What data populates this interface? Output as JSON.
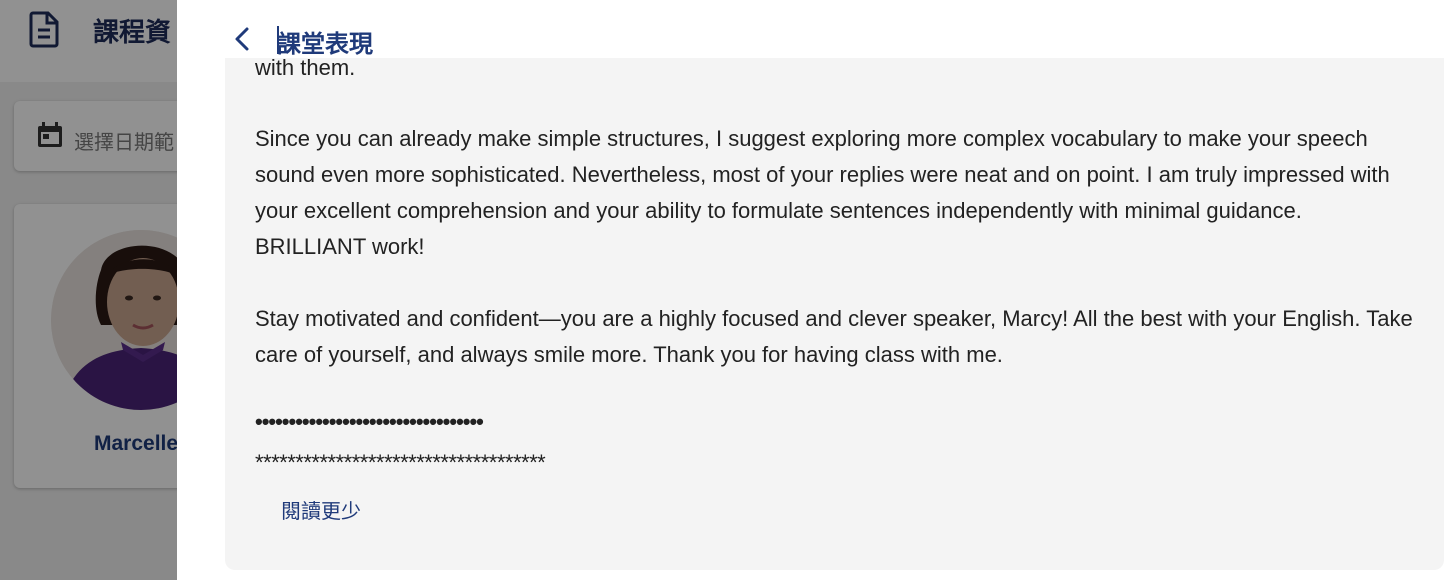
{
  "background": {
    "page_title": "課程資",
    "date_picker_placeholder": "選擇日期範",
    "tutor_name": "Marcelle"
  },
  "drawer": {
    "title": "課堂表現",
    "paragraphs": [
      "with them.",
      "Since you can already make simple structures, I suggest exploring more complex vocabulary to make your speech sound even more sophisticated. Nevertheless, most of your replies were neat and on point. I am truly impressed with your excellent comprehension and your ability to formulate sentences independently with minimal guidance. BRILLIANT work!",
      "Stay motivated and confident—you are a highly focused and clever speaker, Marcy! All the best with your English. Take care of yourself, and always smile more. Thank you for having class with me."
    ],
    "separator_dots": "••••••••••••••••••••••••••••••••••",
    "separator_stars": "************************************",
    "read_less_label": "閱讀更少"
  },
  "colors": {
    "accent": "#1f3a7a",
    "panel_bg": "#f4f4f4",
    "overlay": "rgba(0,0,0,0.43)"
  },
  "icons": {
    "header": "document-icon",
    "date": "calendar-icon",
    "back": "chevron-left-icon"
  }
}
